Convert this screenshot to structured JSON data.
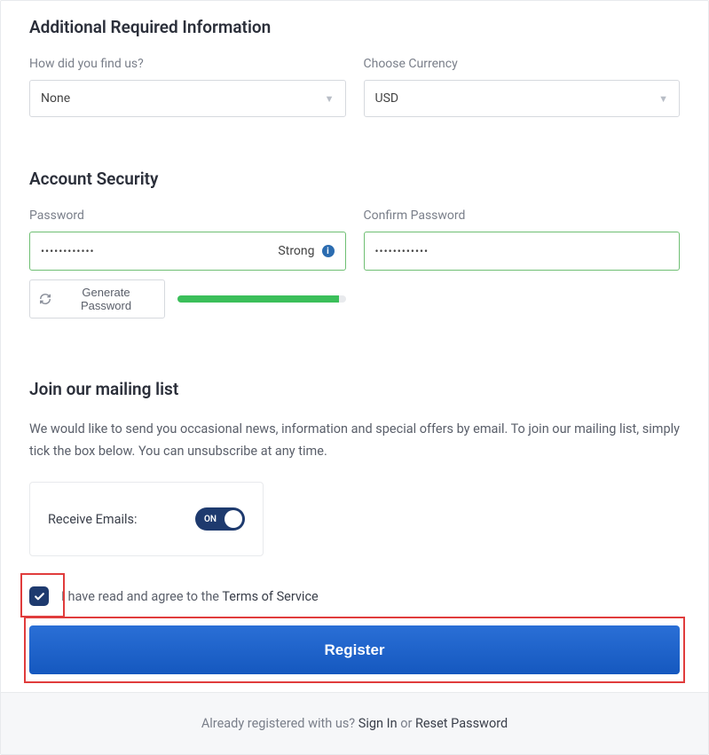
{
  "additional": {
    "title": "Additional Required Information",
    "how_found_label": "How did you find us?",
    "how_found_value": "None",
    "currency_label": "Choose Currency",
    "currency_value": "USD"
  },
  "security": {
    "title": "Account Security",
    "password_label": "Password",
    "password_value": "••••••••••••",
    "confirm_label": "Confirm Password",
    "confirm_value": "••••••••••••",
    "strength_label": "Strong",
    "generate_label": "Generate Password"
  },
  "mailing": {
    "title": "Join our mailing list",
    "description": "We would like to send you occasional news, information and special offers by email. To join our mailing list, simply tick the box below. You can unsubscribe at any time.",
    "receive_label": "Receive Emails:",
    "toggle_on_label": "ON"
  },
  "tos": {
    "prefix": "I have read and agree to the ",
    "link_text": "Terms of Service"
  },
  "register_label": "Register",
  "footer": {
    "prefix": "Already registered with us? ",
    "signin": "Sign In",
    "or": " or ",
    "reset": "Reset Password"
  }
}
